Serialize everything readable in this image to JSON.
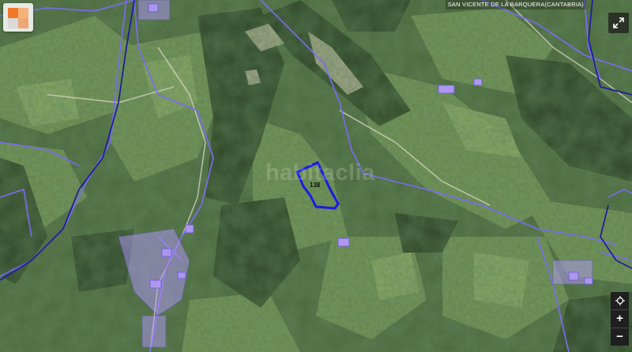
{
  "map": {
    "location_label": "SAN VICENTE DE LA BARQUERA(CANTABRIA)",
    "watermark_text": "habitaclia",
    "parcel_number": "138",
    "colors": {
      "parcel_boundary": "#1a1ae6",
      "cadastral_lines": "#7a6cf0",
      "municipal_boundary": "#1c1c9e",
      "building_fill": "#b79aff"
    }
  },
  "controls": {
    "fullscreen_icon": "expand-arrows-icon",
    "locate_icon": "crosshair-icon",
    "zoom_in_label": "+",
    "zoom_out_label": "−"
  },
  "layer_switcher": {
    "icon": "layers-icon",
    "colors": [
      "#f07a2a",
      "#f5b27a",
      "#d9d9d9",
      "#f07a2a"
    ]
  }
}
